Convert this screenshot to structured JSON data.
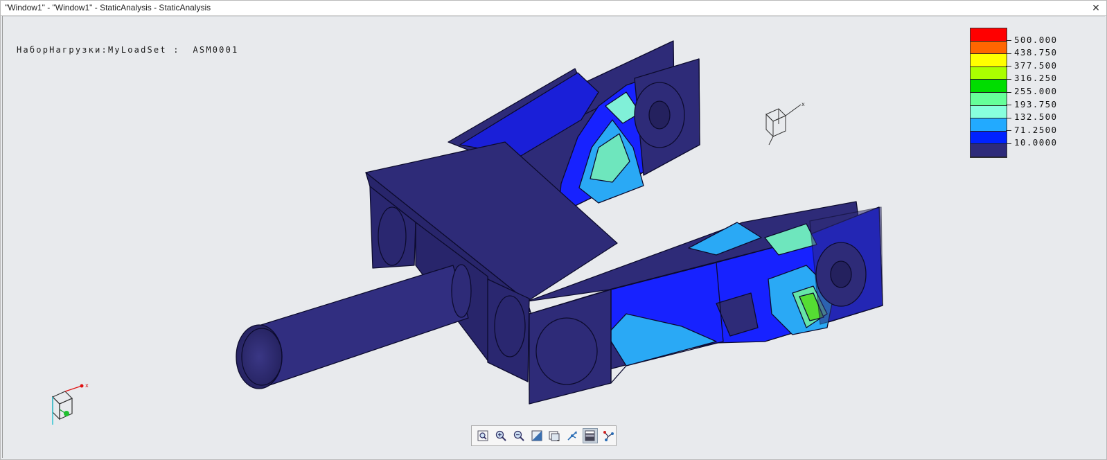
{
  "window": {
    "title": "\"Window1\" - \"Window1\" - StaticAnalysis - StaticAnalysis",
    "close_glyph": "✕"
  },
  "viewport": {
    "loadset_label": "НаборНагрузки:MyLoadSet :  ASM0001",
    "axis_label_x": "x",
    "legend": {
      "colors": [
        "#ff0000",
        "#ff6600",
        "#ffff00",
        "#aaff00",
        "#00dd00",
        "#66ff99",
        "#88ffdd",
        "#22aaff",
        "#0022ff",
        "#2e2b7a"
      ],
      "labels": [
        "500.000",
        "438.750",
        "377.500",
        "316.250",
        "255.000",
        "193.750",
        "132.500",
        "71.2500",
        "10.0000"
      ]
    }
  },
  "toolbar": {
    "buttons": [
      {
        "name": "zoom-fit-icon"
      },
      {
        "name": "zoom-in-icon"
      },
      {
        "name": "zoom-out-icon"
      },
      {
        "name": "refit-icon"
      },
      {
        "name": "saved-views-icon"
      },
      {
        "name": "spin-center-icon"
      },
      {
        "name": "display-style-icon",
        "active": true
      },
      {
        "name": "annotations-icon"
      }
    ]
  }
}
